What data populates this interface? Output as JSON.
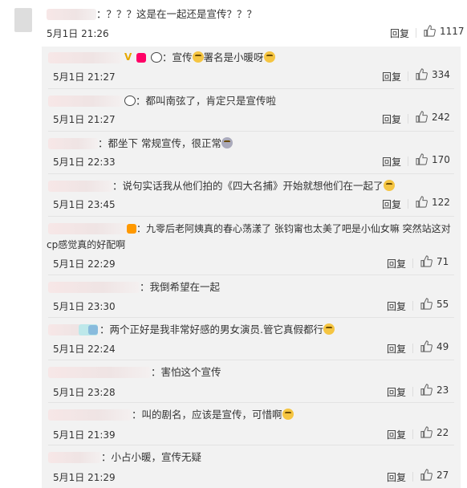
{
  "main_comment": {
    "text": "：？？？这是在一起还是宣传？？？",
    "time": "5月1日 21:26",
    "reply_label": "回复",
    "likes": "1117"
  },
  "replies": [
    {
      "text": "：宣传",
      "text2": "署名是小暖呀",
      "time": "5月1日 21:27",
      "reply_label": "回复",
      "likes": "334"
    },
    {
      "text": "：都叫南弦了，肯定只是宣传啦",
      "time": "5月1日 21:27",
      "reply_label": "回复",
      "likes": "242"
    },
    {
      "text": "：都坐下 常规宣传，很正常",
      "time": "5月1日 22:33",
      "reply_label": "回复",
      "likes": "170"
    },
    {
      "text": "：说句实话我从他们拍的《四大名捕》开始就想他们在一起了",
      "time": "5月1日 23:45",
      "reply_label": "回复",
      "likes": "122"
    },
    {
      "text": "：九零后老阿姨真的春心荡漾了 张钧甯也太美了吧是小仙女嘛 突然站这对",
      "text2": "cp感觉真的好配啊",
      "time": "5月1日 22:29",
      "reply_label": "回复",
      "likes": "71"
    },
    {
      "text": "：我倒希望在一起",
      "time": "5月1日 23:30",
      "reply_label": "回复",
      "likes": "55"
    },
    {
      "text": "：两个正好是我非常好感的男女演员.管它真假都行",
      "time": "5月1日 22:24",
      "reply_label": "回复",
      "likes": "49"
    },
    {
      "text": "：害怕这个宣传",
      "time": "5月1日 23:28",
      "reply_label": "回复",
      "likes": "23"
    },
    {
      "text": "：叫的剧名，应该是宣传，可惜啊",
      "time": "5月1日 21:39",
      "reply_label": "回复",
      "likes": "22"
    },
    {
      "text": "：小占小暖，宣传无疑",
      "time": "5月1日 21:29",
      "reply_label": "回复",
      "likes": "27"
    }
  ]
}
